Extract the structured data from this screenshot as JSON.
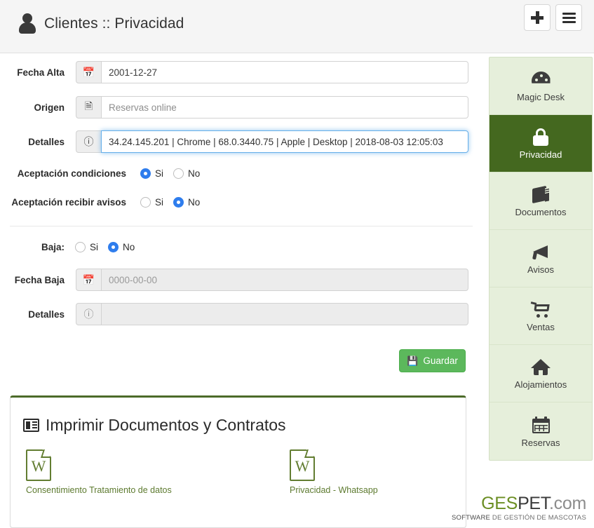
{
  "header": {
    "title": "Clientes :: Privacidad",
    "user_icon": "user-icon",
    "add_button_label": "+",
    "menu_button_label": "☰"
  },
  "form": {
    "fecha_alta": {
      "label": "Fecha Alta",
      "icon": "calendar-icon",
      "value": "2001-12-27",
      "placeholder": ""
    },
    "origen": {
      "label": "Origen",
      "icon": "document-icon",
      "value": "Reservas online",
      "placeholder": "Reservas online"
    },
    "detalles": {
      "label": "Detalles",
      "icon": "info-icon",
      "value": "34.24.145.201 | Chrome | 68.0.3440.75 | Apple | Desktop | 2018-08-03 12:05:03",
      "placeholder": ""
    },
    "aceptacion_condiciones": {
      "label": "Aceptación condiciones",
      "options": [
        "Si",
        "No"
      ],
      "selected": "Si"
    },
    "aceptacion_avisos": {
      "label": "Aceptación recibir avisos",
      "options": [
        "Si",
        "No"
      ],
      "selected": "No"
    },
    "baja": {
      "label": "Baja:",
      "options": [
        "Si",
        "No"
      ],
      "selected": "No"
    },
    "fecha_baja": {
      "label": "Fecha Baja",
      "icon": "calendar-icon",
      "value": "",
      "placeholder": "0000-00-00"
    },
    "detalles_baja": {
      "label": "Detalles",
      "icon": "info-icon",
      "value": "",
      "placeholder": ""
    },
    "save_button": {
      "label": "Guardar",
      "icon": "save-icon",
      "color": "#5cb85c"
    }
  },
  "documents_panel": {
    "title": "Imprimir Documentos y Contratos",
    "title_icon": "newspaper-icon",
    "accent_color": "#4c6b29",
    "items": [
      {
        "label": "Consentimiento Tratamiento de datos",
        "icon": "word-file-icon",
        "glyph": "W"
      },
      {
        "label": "Privacidad - Whatsapp",
        "icon": "word-file-icon",
        "glyph": "W"
      }
    ]
  },
  "sidebar": {
    "background": "#e6efdb",
    "active_color": "#44681f",
    "items": [
      {
        "label": "Magic Desk",
        "icon": "gauge-icon",
        "active": false
      },
      {
        "label": "Privacidad",
        "icon": "lock-icon",
        "active": true
      },
      {
        "label": "Documentos",
        "icon": "book-icon",
        "active": false
      },
      {
        "label": "Avisos",
        "icon": "megaphone-icon",
        "active": false
      },
      {
        "label": "Ventas",
        "icon": "cart-icon",
        "active": false
      },
      {
        "label": "Alojamientos",
        "icon": "home-icon",
        "active": false
      },
      {
        "label": "Reservas",
        "icon": "calendar-icon",
        "active": false
      }
    ]
  },
  "logo": {
    "part1": "GES",
    "part2": "PET",
    "part3": ".com",
    "tagline_bold": "SOFTWARE",
    "tagline_rest": " DE GESTIÓN DE MASCOTAS"
  }
}
